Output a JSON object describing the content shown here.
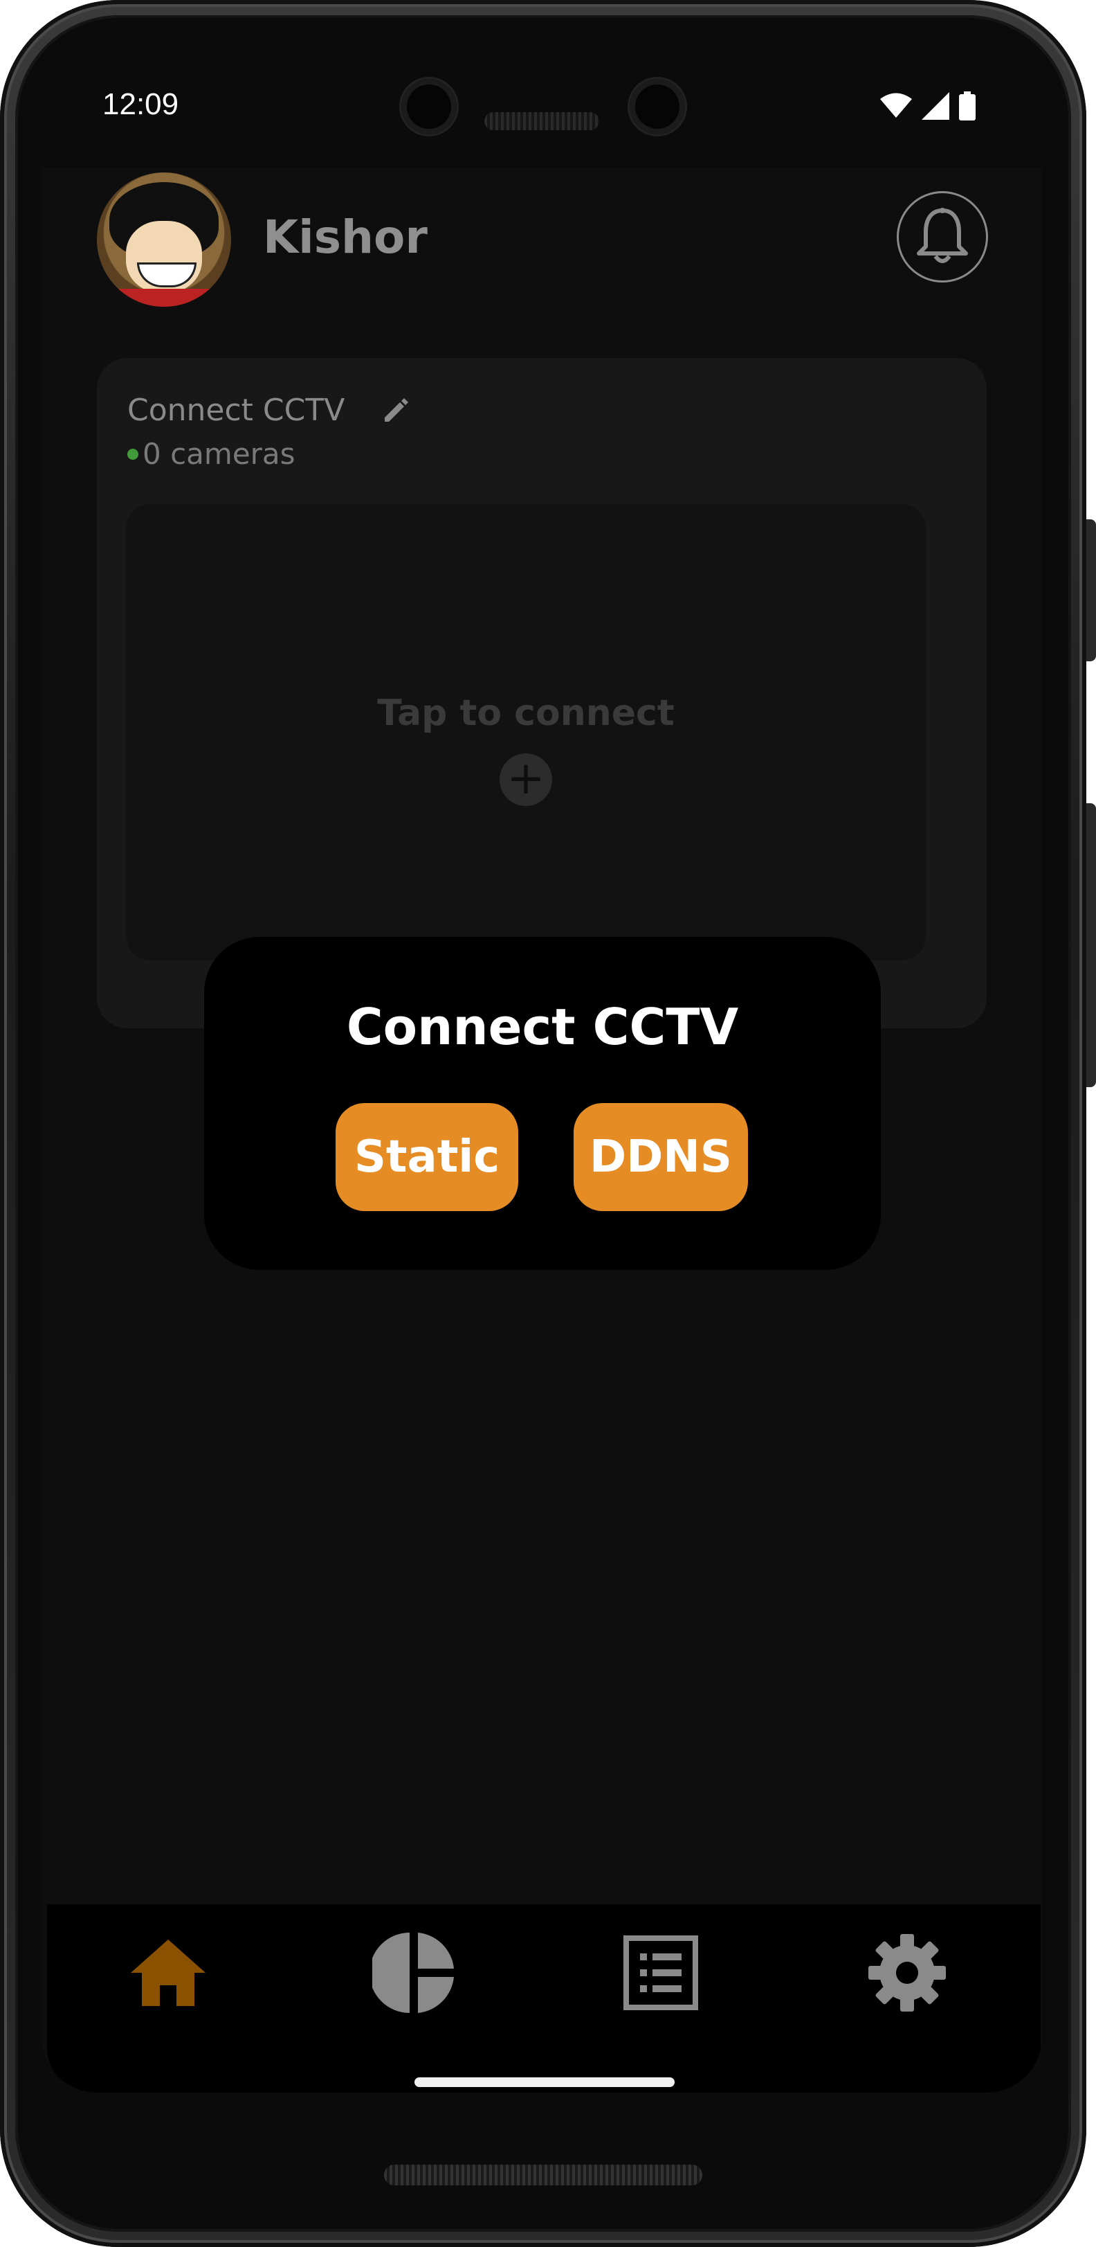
{
  "status_bar": {
    "time": "12:09",
    "icons": [
      "wifi-icon",
      "signal-icon",
      "battery-icon"
    ]
  },
  "header": {
    "username": "Kishor",
    "avatar_icon": "avatar-image",
    "notification_icon": "bell-icon"
  },
  "card": {
    "title": "Connect CCTV",
    "edit_icon": "pencil-icon",
    "camera_count": "0 cameras",
    "status_color": "#3f9a3a",
    "tap_label": "Tap to connect",
    "add_icon": "plus-circle-icon"
  },
  "dialog": {
    "title": "Connect CCTV",
    "buttons": [
      "Static",
      "DDNS"
    ],
    "button_color": "#e58d24"
  },
  "bottom_nav": {
    "items": [
      {
        "name": "home",
        "icon": "home-icon",
        "active": true,
        "color": "#8a5200"
      },
      {
        "name": "analytics",
        "icon": "pie-chart-icon",
        "active": false
      },
      {
        "name": "list",
        "icon": "list-icon",
        "active": false
      },
      {
        "name": "settings",
        "icon": "gear-icon",
        "active": false
      }
    ]
  }
}
